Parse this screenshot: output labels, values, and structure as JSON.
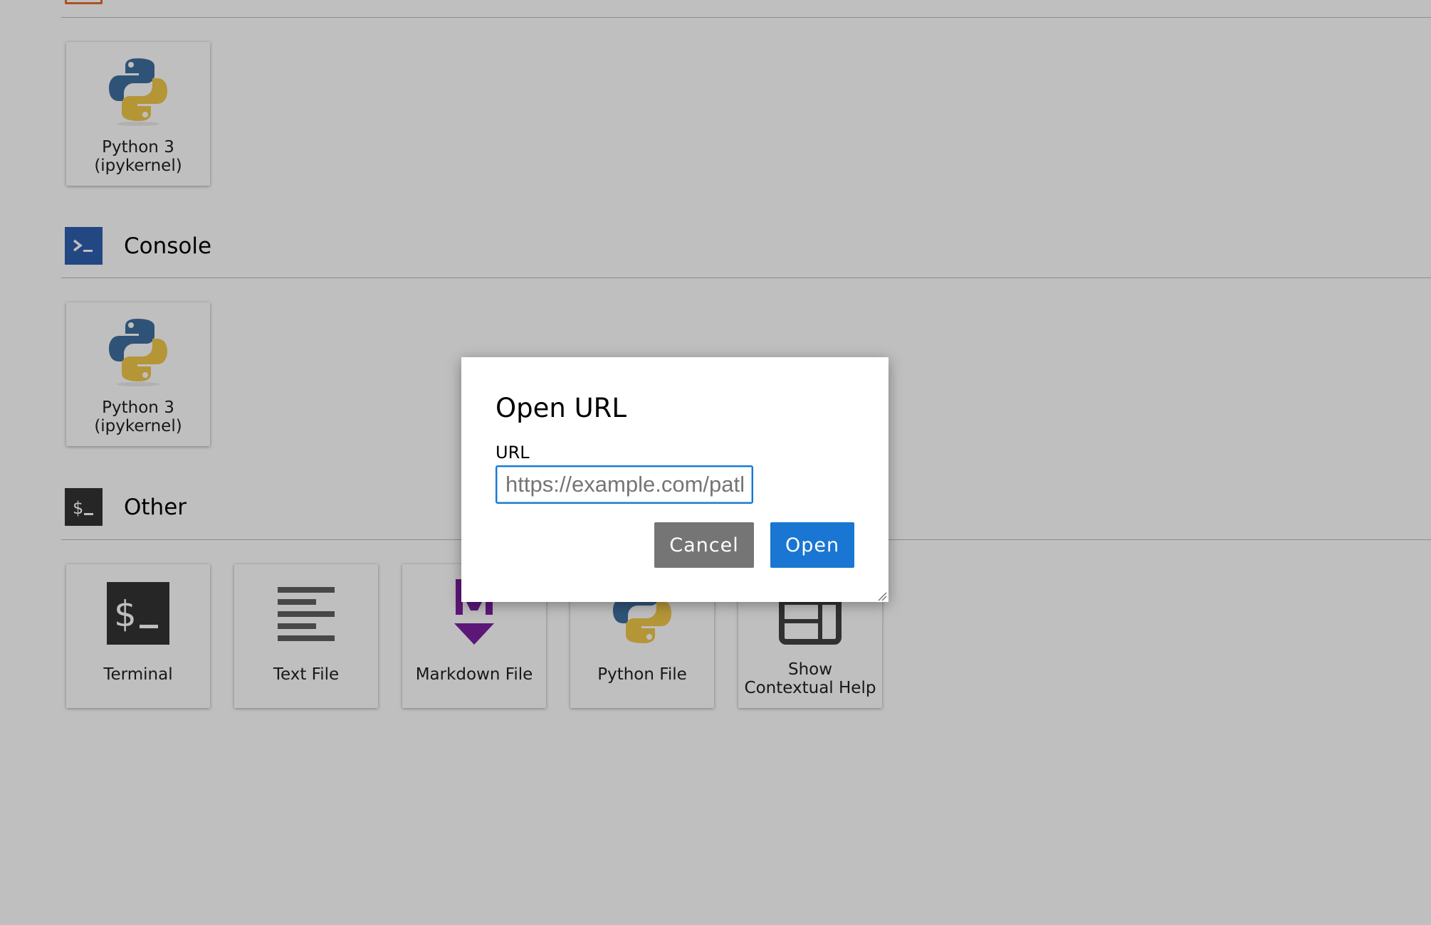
{
  "sections": {
    "console": {
      "title": "Console"
    },
    "other": {
      "title": "Other"
    }
  },
  "notebook_cards": [
    {
      "label_line1": "Python 3",
      "label_line2": "(ipykernel)",
      "icon": "python-icon"
    }
  ],
  "console_cards": [
    {
      "label_line1": "Python 3",
      "label_line2": "(ipykernel)",
      "icon": "python-icon"
    }
  ],
  "other_cards": [
    {
      "label": "Terminal",
      "icon": "terminal-icon"
    },
    {
      "label": "Text File",
      "icon": "text-file-icon"
    },
    {
      "label": "Markdown File",
      "icon": "markdown-icon"
    },
    {
      "label": "Python File",
      "icon": "python-icon"
    },
    {
      "label_line1": "Show",
      "label_line2": "Contextual Help",
      "icon": "contextual-help-icon"
    }
  ],
  "dialog": {
    "title": "Open URL",
    "field_label": "URL",
    "input_value": "",
    "input_placeholder": "https://example.com/path",
    "cancel_label": "Cancel",
    "open_label": "Open"
  },
  "colors": {
    "console_icon_bg": "#2f5fae",
    "terminal_icon_bg": "#333333",
    "markdown_purple": "#7b1fa2",
    "python_blue": "#3f6f9f",
    "python_yellow": "#f0c94a",
    "accent": "#1976d2",
    "cancel_gray": "#757575",
    "notebook_icon_orange": "#e46e2e"
  }
}
